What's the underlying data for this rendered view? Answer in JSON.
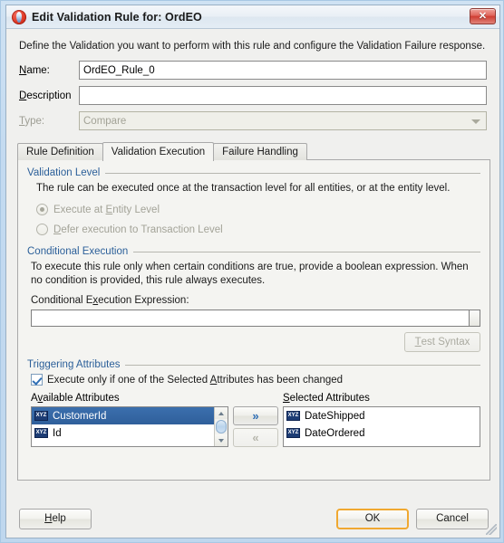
{
  "window": {
    "title": "Edit Validation Rule for: OrdEO",
    "app_icon": "oracle-jdeveloper-icon",
    "close_label": "✕",
    "intro": "Define the Validation you want to perform with this rule and configure the Validation Failure response."
  },
  "fields": {
    "name": {
      "label": "Name:",
      "mnemonic": "N",
      "value": "OrdEO_Rule_0",
      "placeholder": ""
    },
    "description": {
      "label": "Description",
      "mnemonic": "D",
      "value": "",
      "placeholder": ""
    },
    "type": {
      "label": "Type:",
      "mnemonic": "T",
      "value": "Compare",
      "disabled": true
    }
  },
  "tabs": [
    {
      "label": "Rule Definition",
      "active": false
    },
    {
      "label": "Validation Execution",
      "active": true
    },
    {
      "label": "Failure Handling",
      "active": false
    }
  ],
  "validation_level": {
    "group_title": "Validation Level",
    "description": "The rule can be executed once at the transaction level for all entities, or at the entity level.",
    "options": [
      {
        "label_pre": "Execute at ",
        "mnemonic": "E",
        "label_post": "ntity Level",
        "checked": true,
        "disabled": true
      },
      {
        "label_pre": "",
        "mnemonic": "D",
        "label_post": "efer execution to Transaction Level",
        "checked": false,
        "disabled": true
      }
    ]
  },
  "conditional_execution": {
    "group_title": "Conditional Execution",
    "description": "To execute this rule only when certain conditions are true, provide a boolean expression. When no condition is provided, this rule always executes.",
    "expression_label_pre": "Conditional E",
    "expression_mnemonic": "x",
    "expression_label_post": "ecution Expression:",
    "expression_value": "",
    "expression_placeholder": "",
    "edit_button_icon": "expression-editor-icon",
    "test_button_pre": "T",
    "test_button_mnemonic": "e",
    "test_button_post": "st Syntax",
    "test_button_label": "Test Syntax",
    "test_button_disabled": true
  },
  "triggering_attributes": {
    "group_title": "Triggering Attributes",
    "checkbox": {
      "checked": true,
      "label_pre": "Execute only if one of the Selected ",
      "mnemonic": "A",
      "label_post": "ttributes has been changed"
    },
    "available_label_pre": "A",
    "available_mnemonic": "v",
    "available_label_post": "ailable Attributes",
    "available_label": "Available Attributes",
    "selected_label_pre": "",
    "selected_mnemonic": "S",
    "selected_label_post": "elected Attributes",
    "selected_label": "Selected Attributes",
    "available_items": [
      {
        "icon": "xyz-attribute-icon",
        "icon_text": "XYZ",
        "label": "CustomerId",
        "selected": true
      },
      {
        "icon": "xyz-attribute-icon",
        "icon_text": "XYZ",
        "label": "Id",
        "selected": false
      }
    ],
    "selected_items": [
      {
        "icon": "xyz-attribute-icon",
        "icon_text": "XYZ",
        "label": "DateShipped",
        "selected": false
      },
      {
        "icon": "xyz-attribute-icon",
        "icon_text": "XYZ",
        "label": "DateOrdered",
        "selected": false
      }
    ],
    "move_right_glyph": "»",
    "move_left_glyph": "«",
    "move_right_enabled": true,
    "move_left_enabled": false
  },
  "footer": {
    "help_pre": "H",
    "help_mnemonic": "e",
    "help_post": "lp",
    "help_label": "Help",
    "ok_label": "OK",
    "cancel_label": "Cancel"
  },
  "colors": {
    "group_title": "#2b5f99",
    "selection": "#2f5f9b",
    "default_button_border": "#f0a830",
    "window_frame": "#c3daf0",
    "panel_bg": "#f4f4f1"
  }
}
